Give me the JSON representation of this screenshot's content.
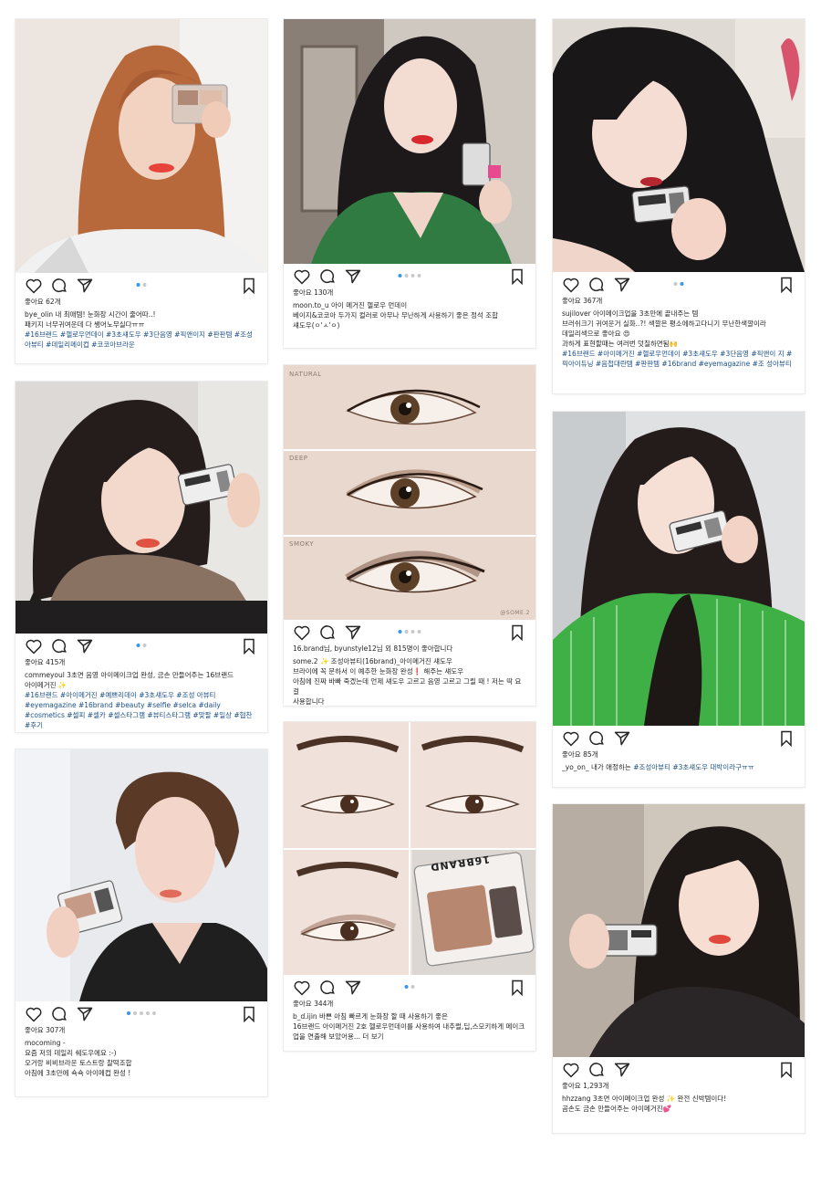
{
  "icons": {
    "like": "heart-icon",
    "comment": "comment-icon",
    "share": "paper-plane-icon",
    "save": "bookmark-icon"
  },
  "posts": [
    {
      "likes": "좋아요 62개",
      "caption": "bye_olin 내 최애템! 눈화장 시간이 줄어따..!\n패키지 너무귀여운데 다 쌩어노무실다ㅠㅠ",
      "tags": "#16브랜드 #헬로우먼데이 #3초섀도우 #3단음영 #픽앤이지 #판판템 #조성아뷰티 #데일리메이컵 #코코아브라운"
    },
    {
      "likes": "좋아요 130개",
      "caption": "moon.to_u 아이 메거진 헬로우 먼데이\n베이지&코코아 두가지 컬러로 아무나 무난하게 사용하기 좋은 정석 조합\n섀도우(ㅇ'ㅅ'ㅇ)",
      "tags": ""
    },
    {
      "likes": "좋아요 367개",
      "caption": "sujilover 아이메이크업을 3초만에 끝내주는 템\n브러쉬크기 귀여운거 실화..?! 색깔은 평소에하고다니기 무난한색깔이라\n데일리색으로 좋아요 😍\n과하게 표현할때는 여러번 덧칠하면됨🙌",
      "tags": "#16브랜드 #아이메거진 #헬로우먼데이 #3초섀도우 #3단음영 #픽앤이\n지 #픽아이듀닝 #음첩대란템 #판판템 #16brand #eyemagazine #조\n성아뷰티"
    },
    {
      "likes": "좋아요 415개",
      "caption": "commeyoul 3초면 음영 아이메이크업 완성, 금손 만들어주는 16브랜드\n아이메거진 ✨",
      "tags": "#16브랜드 #아이메거진 #예쁘리데이 #3초섀도우 #조성\n아뷰티 #eyemagazine #16brand #beauty #selfie #selca #daily\n#cosmetics #셀피 #셀카 #셀스타그램 #뷰티스타그램 #맞팔 #일상\n#협찬 #후기"
    },
    {
      "likes": "16.brand님, byunstyle12님 외 815명이 좋아합니다",
      "caption": "some.2 ✨ 조성아뷰티(16brand)_아이메거진 섀도우\n브라이에 꼭 문하서 이 예추한 눈화장 완성❗ 해주는 섀도우\n아침에 진짜 바빠 죽겠는데 언제 섀도우 고르고 음영 고르고 그릴 때 ! 저는 딱 요걸\n사용합니다",
      "tags": ""
    },
    {
      "likes": "좋아요 85개",
      "caption": "_yo_on_ 내가 애정하는",
      "tags": "#조성아뷰티 #3초섀도우 대박이라구ㅠㅠ"
    },
    {
      "likes": "좋아요 307개",
      "caption": "mocoming -\n요즘 저의 데일리 쉐도우에요 :-)\n오거랑 비비브라운 토스트랑 찰떡조합\n아침에 3초만에 쇽쇽 아이메컵 완성 !",
      "tags": ""
    },
    {
      "likes": "좋아요 344개",
      "caption": "b_d.ijin 바쁜 아침 빠르게 눈화장 할 때 사용하기 좋은\n16브랜드 아이메거진 2호 헬로우먼데이를 사용하여 내추럴,딥,스모키하게 메이크\n업을 연출해 보았어용... 더 보기",
      "tags": ""
    },
    {
      "likes": "좋아요 1,293개",
      "caption": "hhzzang 3초면 아이메이크업 완성 ✨ 완전 신박템이다!\n곰손도 금손 만들어주는 아이메거진💕",
      "tags": ""
    }
  ],
  "eye_labels": [
    "NATURAL",
    "DEEP",
    "SMOKY"
  ],
  "watermark": "@SOME.2",
  "package_text": "16BRAND"
}
